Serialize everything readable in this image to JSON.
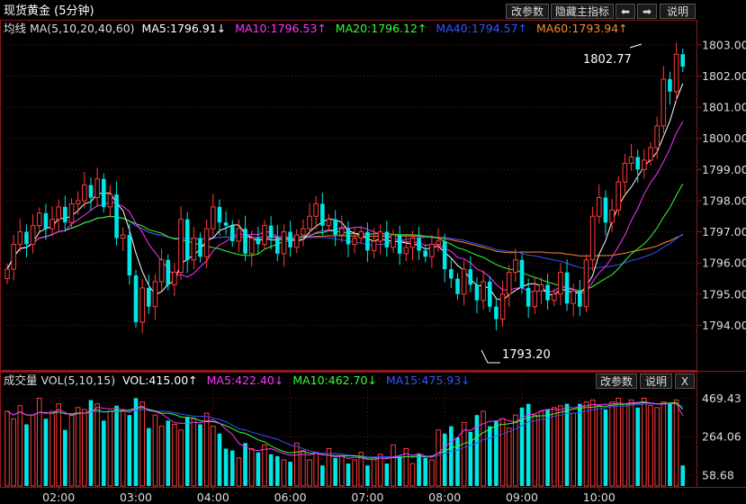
{
  "header": {
    "title": "现货黄金 (5分钟)",
    "buttons": {
      "params": "改参数",
      "hide": "隐藏主指标",
      "prev": "⬅",
      "next": "➡",
      "help": "说明"
    }
  },
  "ma_legend": {
    "label": "均线 MA(5,10,20,40,60)",
    "items": [
      {
        "text": "MA5:1796.91↓",
        "color": "#ffffff"
      },
      {
        "text": "MA10:1796.53↑",
        "color": "#ff33ff"
      },
      {
        "text": "MA20:1796.12↑",
        "color": "#33ff33"
      },
      {
        "text": "MA40:1794.57↑",
        "color": "#3355ff"
      },
      {
        "text": "MA60:1793.94↑",
        "color": "#ff8a2a"
      }
    ]
  },
  "vol_legend": {
    "label": "成交量 VOL(5,10,15)",
    "items": [
      {
        "text": "VOL:415.00↑",
        "color": "#ffffff"
      },
      {
        "text": "MA5:422.40↓",
        "color": "#ff33ff"
      },
      {
        "text": "MA10:462.70↓",
        "color": "#33ff33"
      },
      {
        "text": "MA15:475.93↓",
        "color": "#3355ff"
      }
    ],
    "buttons": {
      "params": "改参数",
      "help": "说明",
      "close": "X"
    }
  },
  "annotations": {
    "high": "1802.77",
    "low": "1793.20"
  },
  "chart_data": {
    "type": "candlestick",
    "price_ylim": [
      1792.8,
      1803.4
    ],
    "price_ticks": [
      "1803.00",
      "1802.00",
      "1801.00",
      "1800.00",
      "1799.00",
      "1798.00",
      "1797.00",
      "1796.00",
      "1795.00",
      "1794.00"
    ],
    "volume_ylim": [
      0,
      530
    ],
    "volume_ticks": [
      "469.43",
      "264.06",
      "58.68"
    ],
    "x_ticks": [
      {
        "label": "02:00",
        "index": 8
      },
      {
        "label": "03:00",
        "index": 20
      },
      {
        "label": "04:00",
        "index": 32
      },
      {
        "label": "06:00",
        "index": 44
      },
      {
        "label": "07:00",
        "index": 56
      },
      {
        "label": "08:00",
        "index": 68
      },
      {
        "label": "09:00",
        "index": 80
      },
      {
        "label": "10:00",
        "index": 92
      }
    ],
    "high": 1802.77,
    "low": 1793.2,
    "candles": [
      1795.8,
      1796.6,
      1797.0,
      1796.6,
      1797.2,
      1797.6,
      1797.1,
      1797.4,
      1797.8,
      1797.3,
      1797.9,
      1798.0,
      1798.5,
      1798.1,
      1798.7,
      1797.8,
      1798.2,
      1796.8,
      1796.9,
      1795.6,
      1794.1,
      1795.2,
      1794.6,
      1795.4,
      1796.1,
      1795.3,
      1795.7,
      1797.4,
      1796.1,
      1796.8,
      1796.2,
      1797.1,
      1797.8,
      1797.3,
      1797.2,
      1796.7,
      1797.1,
      1796.3,
      1796.8,
      1796.6,
      1797.2,
      1796.8,
      1796.3,
      1797.0,
      1796.5,
      1796.9,
      1797.1,
      1797.5,
      1797.9,
      1797.2,
      1797.4,
      1796.9,
      1797.1,
      1796.6,
      1796.8,
      1797.0,
      1796.4,
      1796.7,
      1797.0,
      1796.5,
      1796.9,
      1796.3,
      1796.5,
      1796.8,
      1796.4,
      1796.2,
      1796.6,
      1796.7,
      1795.8,
      1795.5,
      1795.0,
      1795.8,
      1795.3,
      1794.8,
      1795.4,
      1794.6,
      1794.2,
      1795.0,
      1795.7,
      1796.1,
      1795.2,
      1794.6,
      1795.1,
      1795.3,
      1794.8,
      1795.0,
      1795.7,
      1794.7,
      1795.1,
      1794.6,
      1796.1,
      1797.5,
      1798.1,
      1797.3,
      1797.7,
      1798.6,
      1799.2,
      1799.4,
      1799.0,
      1799.3,
      1799.7,
      1800.4,
      1801.9,
      1801.5,
      1802.7,
      1802.3
    ],
    "volumes": [
      400,
      360,
      430,
      330,
      380,
      470,
      360,
      400,
      440,
      300,
      380,
      420,
      410,
      460,
      440,
      350,
      400,
      430,
      410,
      380,
      470,
      450,
      310,
      380,
      320,
      350,
      330,
      300,
      370,
      360,
      330,
      390,
      320,
      280,
      200,
      190,
      150,
      230,
      200,
      180,
      220,
      170,
      160,
      140,
      130,
      230,
      190,
      140,
      180,
      110,
      200,
      150,
      160,
      120,
      140,
      180,
      110,
      150,
      170,
      120,
      220,
      160,
      200,
      120,
      170,
      150,
      140,
      300,
      280,
      320,
      260,
      340,
      290,
      380,
      400,
      320,
      350,
      360,
      310,
      380,
      420,
      440,
      380,
      400,
      410,
      420,
      430,
      440,
      390,
      440,
      450,
      460,
      430,
      410,
      450,
      470,
      440,
      460,
      420,
      470,
      430,
      420,
      450,
      440,
      460,
      110
    ]
  }
}
